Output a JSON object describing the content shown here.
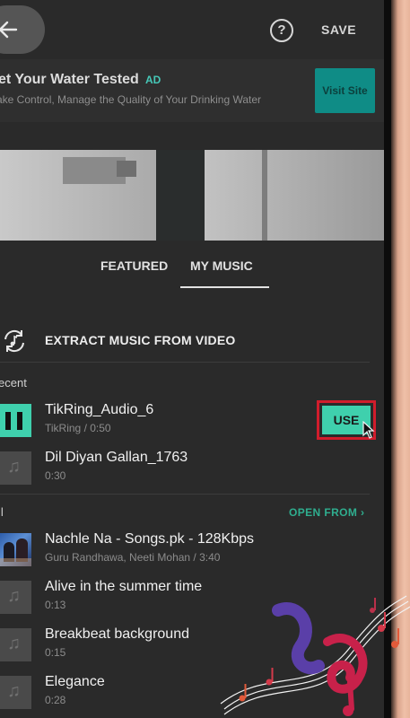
{
  "topbar": {
    "save_label": "SAVE",
    "help_glyph": "?"
  },
  "ad": {
    "title": "et Your Water Tested",
    "badge": "AD",
    "subtitle": "ake Control, Manage the Quality of Your Drinking Water",
    "cta_label": "Visit Site"
  },
  "tabs": [
    {
      "label": "FEATURED",
      "active": false
    },
    {
      "label": "MY MUSIC",
      "active": true
    }
  ],
  "extract": {
    "label": "EXTRACT MUSIC FROM VIDEO"
  },
  "recent": {
    "heading": "ecent",
    "items": [
      {
        "title": "TikRing_Audio_6",
        "subtitle": "TikRing / 0:50",
        "state": "playing",
        "action_label": "USE"
      },
      {
        "title": "Dil Diyan Gallan_1763",
        "subtitle": "0:30",
        "state": "idle"
      }
    ]
  },
  "all": {
    "heading": "ll",
    "open_from_label": "OPEN FROM ›",
    "items": [
      {
        "title": "Nachle Na - Songs.pk - 128Kbps",
        "subtitle": "Guru Randhawa, Neeti Mohan / 3:40",
        "thumb": "album-art"
      },
      {
        "title": "Alive in the summer time",
        "subtitle": "0:13",
        "thumb": "music-note"
      },
      {
        "title": "Breakbeat background",
        "subtitle": "0:15",
        "thumb": "music-note"
      },
      {
        "title": "Elegance",
        "subtitle": "0:28",
        "thumb": "music-note"
      }
    ]
  },
  "colors": {
    "accent": "#3fd0ad",
    "link": "#2fae8f",
    "highlight_box": "#d11d2c",
    "background": "#2a2a2a"
  }
}
